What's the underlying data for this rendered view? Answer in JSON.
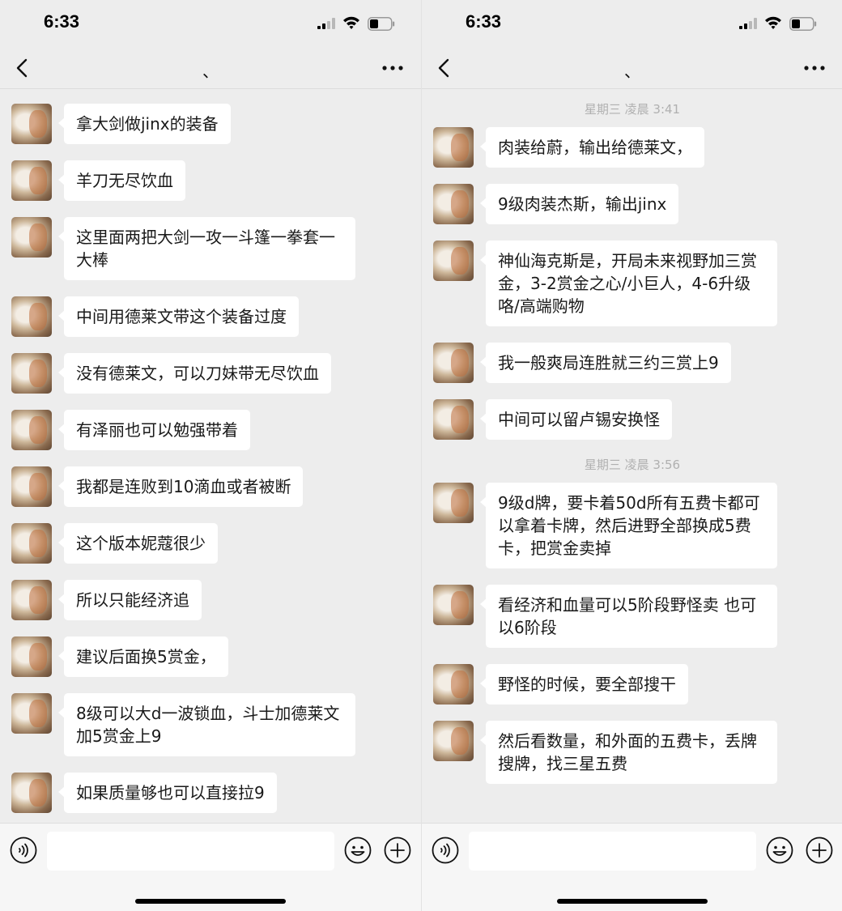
{
  "screens": [
    {
      "status_bar": {
        "time": "6:33"
      },
      "header": {
        "title": "、"
      },
      "messages": [
        {
          "text": "拿大剑做jinx的装备"
        },
        {
          "text": "羊刀无尽饮血"
        },
        {
          "text": "这里面两把大剑一攻一斗篷一拳套一大棒"
        },
        {
          "text": "中间用德莱文带这个装备过度"
        },
        {
          "text": "没有德莱文，可以刀妹带无尽饮血"
        },
        {
          "text": "有泽丽也可以勉强带着"
        },
        {
          "text": "我都是连败到10滴血或者被断"
        },
        {
          "text": "这个版本妮蔻很少"
        },
        {
          "text": "所以只能经济追"
        },
        {
          "text": "建议后面换5赏金，"
        },
        {
          "text": "8级可以大d一波锁血，斗士加德莱文加5赏金上9"
        },
        {
          "text": "如果质量够也可以直接拉9"
        }
      ]
    },
    {
      "status_bar": {
        "time": "6:33"
      },
      "header": {
        "title": "、"
      },
      "timestamps": [
        "星期三 凌晨 3:41",
        "星期三 凌晨 3:56"
      ],
      "messages": [
        {
          "text": "肉装给蔚，输出给德莱文，"
        },
        {
          "text": "9级肉装杰斯，输出jinx"
        },
        {
          "text": "神仙海克斯是，开局未来视野加三赏金，3-2赏金之心/小巨人，4-6升级咯/高端购物"
        },
        {
          "text": "我一般爽局连胜就三约三赏上9"
        },
        {
          "text": "中间可以留卢锡安换怪"
        },
        {
          "text": "9级d牌，要卡着50d所有五费卡都可以拿着卡牌，然后进野全部换成5费卡，把赏金卖掉"
        },
        {
          "text": "看经济和血量可以5阶段野怪卖 也可以6阶段"
        },
        {
          "text": "野怪的时候，要全部搜干"
        },
        {
          "text": "然后看数量，和外面的五费卡，丢牌搜牌，找三星五费"
        }
      ]
    }
  ],
  "icons": {
    "back": "chevron-left-icon",
    "more": "more-dots-icon",
    "voice": "voice-icon",
    "emoji": "emoji-icon",
    "plus": "plus-icon"
  },
  "colors": {
    "background": "#ededed",
    "bubble": "#ffffff",
    "timestamp": "#b0b0b0"
  }
}
